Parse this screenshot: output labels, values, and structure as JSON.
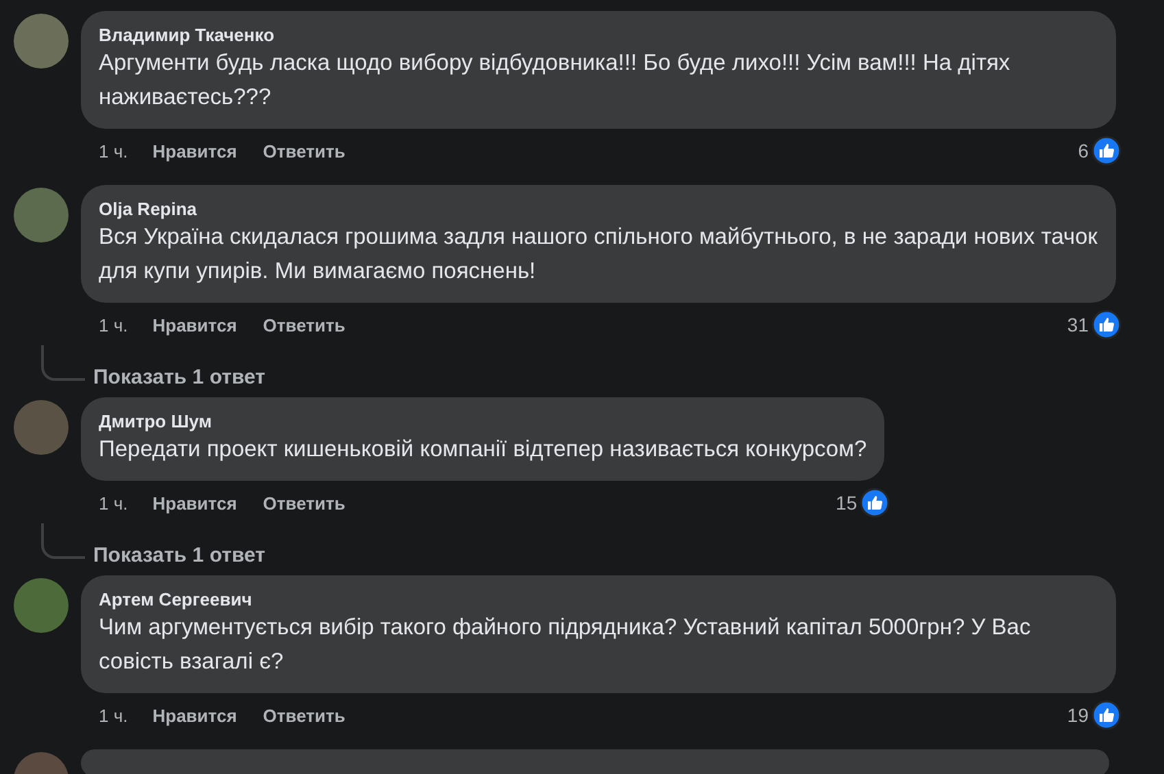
{
  "comments": [
    {
      "author": "Владимир Ткаченко",
      "text": "Аргументи будь ласка щодо вибору відбудовника!!! Бо буде лихо!!! Усім вам!!! На дітях наживаєтесь???",
      "time": "1 ч.",
      "like_label": "Нравится",
      "reply_label": "Ответить",
      "likes": "6"
    },
    {
      "author": "Olja Repina",
      "text": "Вся Україна скидалася грошима задля нашого спільного майбутнього, в не заради нових тачок для купи упирів. Ми вимагаємо пояснень!",
      "time": "1 ч.",
      "like_label": "Нравится",
      "reply_label": "Ответить",
      "likes": "31",
      "replies_link": "Показать 1 ответ"
    },
    {
      "author": "Дмитро Шум",
      "text": "Передати проект кишеньковій компанії відтепер називається конкурсом?",
      "time": "1 ч.",
      "like_label": "Нравится",
      "reply_label": "Ответить",
      "likes": "15",
      "replies_link": "Показать 1 ответ"
    },
    {
      "author": "Артем Сергеевич",
      "text": "Чим аргументується вибір такого файного підрядника? Уставний капітал 5000грн? У Вас совість взагалі є?",
      "time": "1 ч.",
      "like_label": "Нравится",
      "reply_label": "Ответить",
      "likes": "19"
    }
  ]
}
